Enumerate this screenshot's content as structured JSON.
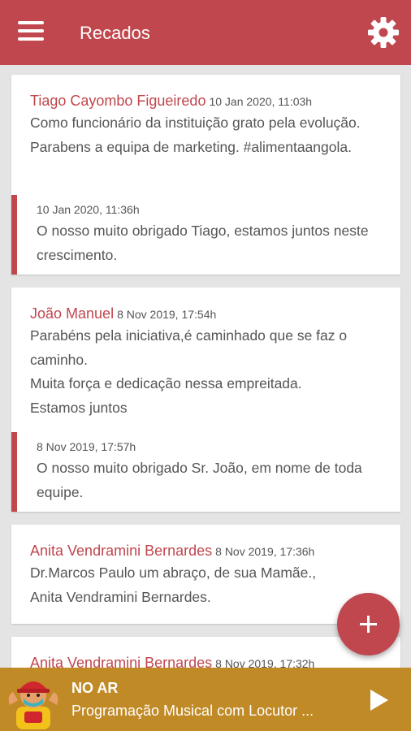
{
  "appbar": {
    "title": "Recados",
    "menu_icon": "hamburger-menu-icon",
    "settings_icon": "gear-icon",
    "color": "#c0474e"
  },
  "messages": [
    {
      "author": "Tiago Cayombo Figueiredo",
      "time": "10 Jan 2020, 11:03h",
      "text": "Como funcionário da instituição grato pela evolução. Parabens a equipa de marketing. #alimentaangola.",
      "reply": {
        "time": "10 Jan 2020, 11:36h",
        "text": "O nosso muito obrigado Tiago, estamos juntos neste crescimento."
      }
    },
    {
      "author": "João Manuel",
      "time": "8 Nov 2019, 17:54h",
      "text": "Parabéns pela iniciativa,é caminhado que se faz o caminho.\nMuita força e dedicação nessa empreitada.\nEstamos juntos",
      "reply": {
        "time": "8 Nov 2019, 17:57h",
        "text": "O nosso muito obrigado Sr. João, em nome de toda equipe."
      }
    },
    {
      "author": "Anita Vendramini Bernardes",
      "time": "8 Nov 2019, 17:36h",
      "text": "Dr.Marcos Paulo um abraço, de sua Mamãe., Anita Vendramini Bernardes."
    },
    {
      "author": "Anita Vendramini Bernardes",
      "time": "8 Nov 2019, 17:32h"
    }
  ],
  "fab": {
    "icon": "plus-icon"
  },
  "player": {
    "status": "NO AR",
    "program": "Programação Musical com Locutor ...",
    "play_icon": "play-icon",
    "background": "#c08a27"
  }
}
